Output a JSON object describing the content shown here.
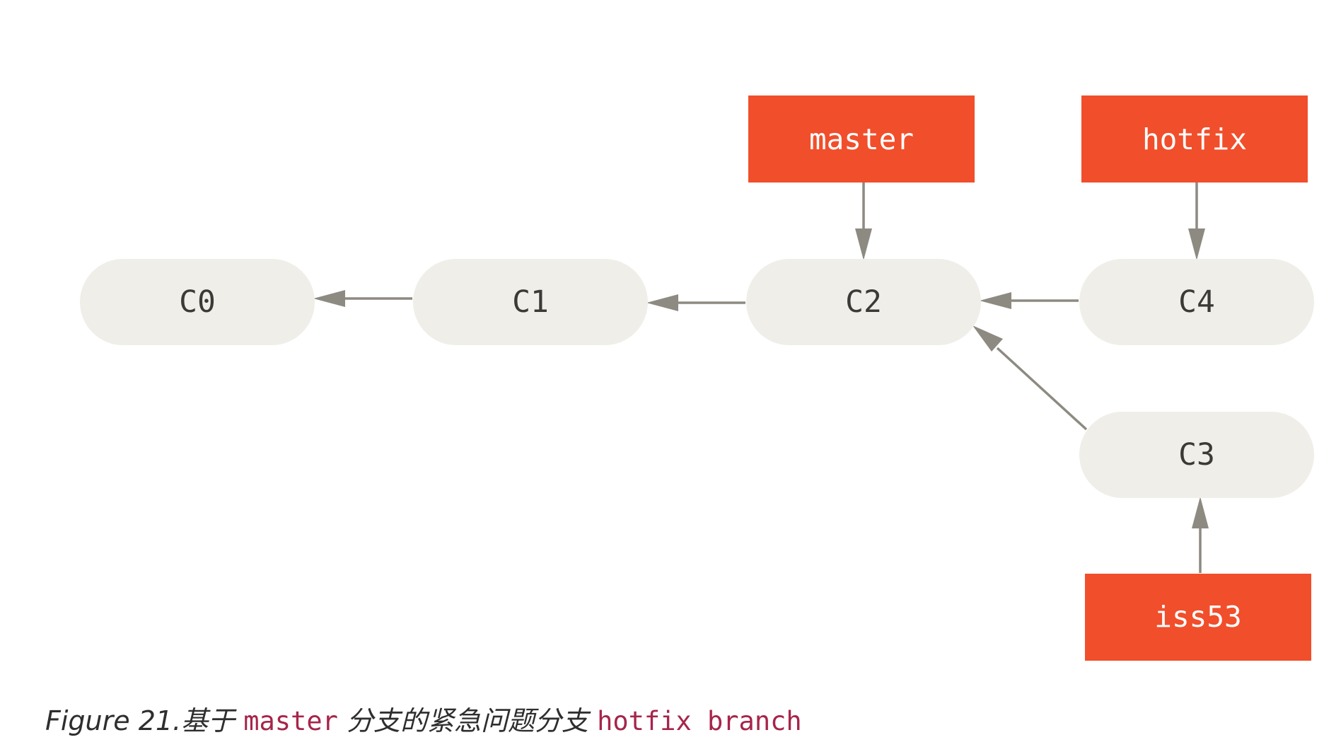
{
  "diagram": {
    "commits": [
      {
        "id": "c0",
        "label": "C0"
      },
      {
        "id": "c1",
        "label": "C1"
      },
      {
        "id": "c2",
        "label": "C2"
      },
      {
        "id": "c4",
        "label": "C4"
      },
      {
        "id": "c3",
        "label": "C3"
      }
    ],
    "branches": [
      {
        "id": "master",
        "label": "master",
        "points_to": "C2"
      },
      {
        "id": "hotfix",
        "label": "hotfix",
        "points_to": "C4"
      },
      {
        "id": "iss53",
        "label": "iss53",
        "points_to": "C3"
      }
    ],
    "parent_edges": [
      {
        "from": "C1",
        "to": "C0"
      },
      {
        "from": "C2",
        "to": "C1"
      },
      {
        "from": "C4",
        "to": "C2"
      },
      {
        "from": "C3",
        "to": "C2"
      }
    ],
    "colors": {
      "commit_fill": "#efeee9",
      "branch_fill": "#f14e2b",
      "arrow": "#8d8a81",
      "caption_code": "#a6254a"
    }
  },
  "caption": {
    "prefix": "Figure 21.",
    "text_1": "基于 ",
    "code_1": "master",
    "text_2": " 分支的紧急问题分支 ",
    "code_2": "hotfix branch"
  }
}
